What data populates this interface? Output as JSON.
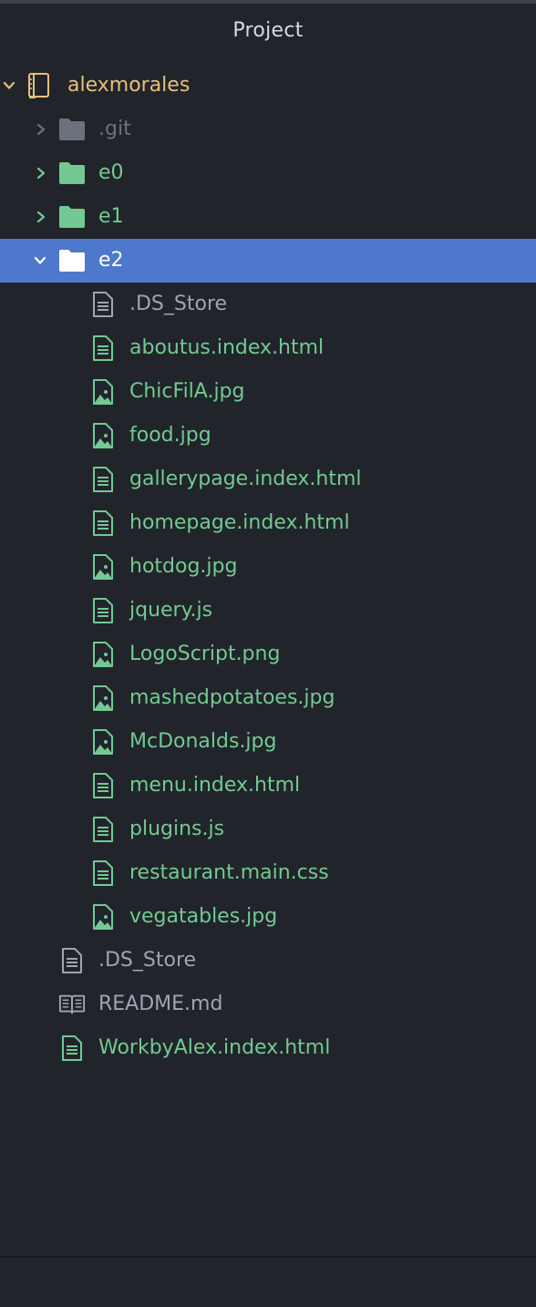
{
  "panel": {
    "title": "Project"
  },
  "tree": {
    "root": {
      "label": "alexmorales",
      "expanded": true
    },
    "folders": [
      {
        "label": ".git",
        "expanded": false,
        "ignored": true
      },
      {
        "label": "e0",
        "expanded": false
      },
      {
        "label": "e1",
        "expanded": false
      },
      {
        "label": "e2",
        "expanded": true,
        "selected": true
      }
    ],
    "e2_files": [
      {
        "label": ".DS_Store",
        "type": "text",
        "status": "none"
      },
      {
        "label": "aboutus.index.html",
        "type": "text",
        "status": "added"
      },
      {
        "label": "ChicFilA.jpg",
        "type": "image",
        "status": "added"
      },
      {
        "label": "food.jpg",
        "type": "image",
        "status": "added"
      },
      {
        "label": "gallerypage.index.html",
        "type": "text",
        "status": "added"
      },
      {
        "label": "homepage.index.html",
        "type": "text",
        "status": "added"
      },
      {
        "label": "hotdog.jpg",
        "type": "image",
        "status": "added"
      },
      {
        "label": "jquery.js",
        "type": "text",
        "status": "added"
      },
      {
        "label": "LogoScript.png",
        "type": "image",
        "status": "added"
      },
      {
        "label": "mashedpotatoes.jpg",
        "type": "image",
        "status": "added"
      },
      {
        "label": "McDonalds.jpg",
        "type": "image",
        "status": "added"
      },
      {
        "label": "menu.index.html",
        "type": "text",
        "status": "added"
      },
      {
        "label": "plugins.js",
        "type": "text",
        "status": "added"
      },
      {
        "label": "restaurant.main.css",
        "type": "text",
        "status": "added"
      },
      {
        "label": "vegatables.jpg",
        "type": "image",
        "status": "added"
      }
    ],
    "root_files": [
      {
        "label": ".DS_Store",
        "type": "text",
        "status": "none"
      },
      {
        "label": "README.md",
        "type": "book",
        "status": "none"
      },
      {
        "label": "WorkbyAlex.index.html",
        "type": "text",
        "status": "added"
      }
    ]
  },
  "colors": {
    "background": "#21252b",
    "selection": "#4d78cc",
    "added": "#73c991",
    "default_text": "#9da5b4",
    "ignored": "#6b717d",
    "root": "#e5c07b"
  }
}
